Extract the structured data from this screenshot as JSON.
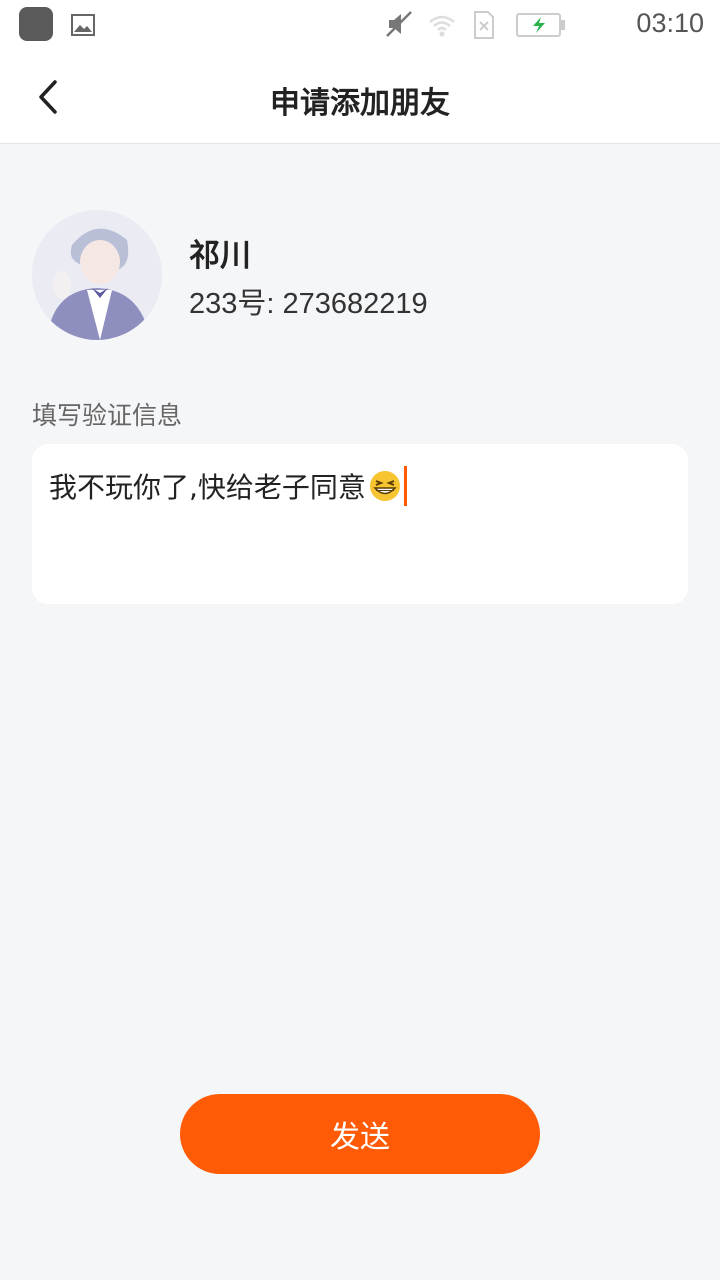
{
  "status_bar": {
    "time": "03:10",
    "icons": [
      "app-icon",
      "gallery-icon",
      "mute-icon",
      "wifi-icon",
      "sim-icon",
      "battery-charging-icon"
    ]
  },
  "header": {
    "back_icon": "chevron-left-icon",
    "title": "申请添加朋友"
  },
  "profile": {
    "name": "祁川",
    "id_text": "233号: 273682219"
  },
  "verification": {
    "label": "填写验证信息",
    "message": "我不玩你了,快给老子同意",
    "emoji": "grinning-squint-emoji",
    "caret_color": "#ff5a00"
  },
  "actions": {
    "send_label": "发送",
    "send_color": "#ff5a05"
  }
}
